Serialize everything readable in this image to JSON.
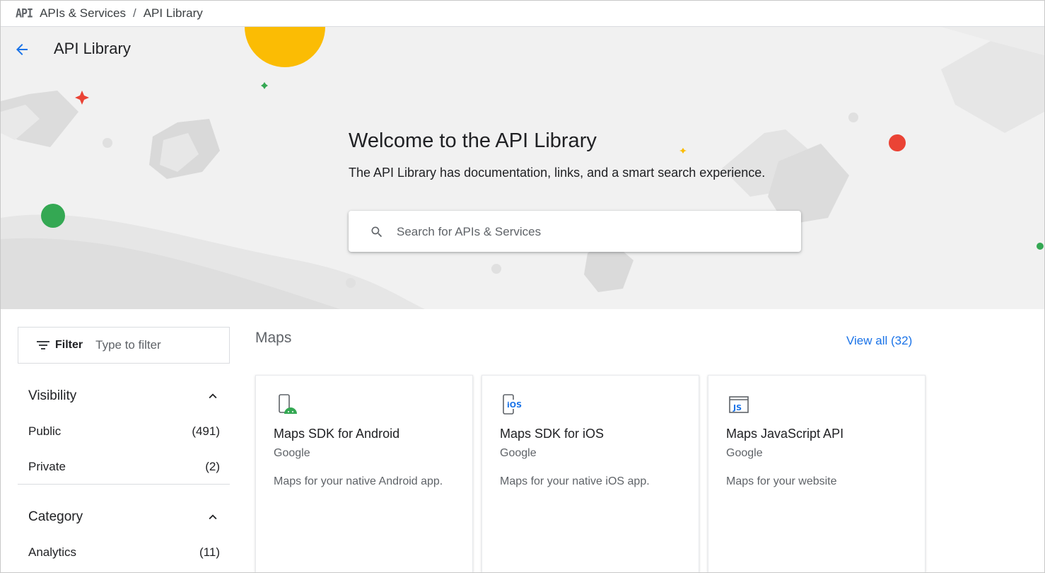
{
  "breadcrumb": {
    "logo_text": "API",
    "items": [
      "APIs & Services",
      "API Library"
    ],
    "separator": "/"
  },
  "hero": {
    "page_title": "API Library",
    "welcome_title": "Welcome to the API Library",
    "welcome_subtitle": "The API Library has documentation, links, and a smart search experience.",
    "search_placeholder": "Search for APIs & Services"
  },
  "sidebar": {
    "filter_label": "Filter",
    "filter_placeholder": "Type to filter",
    "facets": [
      {
        "title": "Visibility",
        "items": [
          {
            "label": "Public",
            "count": "(491)"
          },
          {
            "label": "Private",
            "count": "(2)"
          }
        ]
      },
      {
        "title": "Category",
        "items": [
          {
            "label": "Analytics",
            "count": "(11)"
          }
        ]
      }
    ]
  },
  "maps_section": {
    "title": "Maps",
    "view_all": "View all (32)",
    "cards": [
      {
        "icon": "android-phone-icon",
        "title": "Maps SDK for Android",
        "vendor": "Google",
        "description": "Maps for your native Android app."
      },
      {
        "icon": "ios-phone-icon",
        "title": "Maps SDK for iOS",
        "vendor": "Google",
        "description": "Maps for your native iOS app."
      },
      {
        "icon": "javascript-icon",
        "title": "Maps JavaScript API",
        "vendor": "Google",
        "description": "Maps for your website"
      }
    ]
  },
  "colors": {
    "accent": "#1a73e8",
    "hero_bg": "#f1f1f1",
    "yellow": "#fbbc04",
    "red": "#ea4335",
    "green": "#34a853"
  }
}
